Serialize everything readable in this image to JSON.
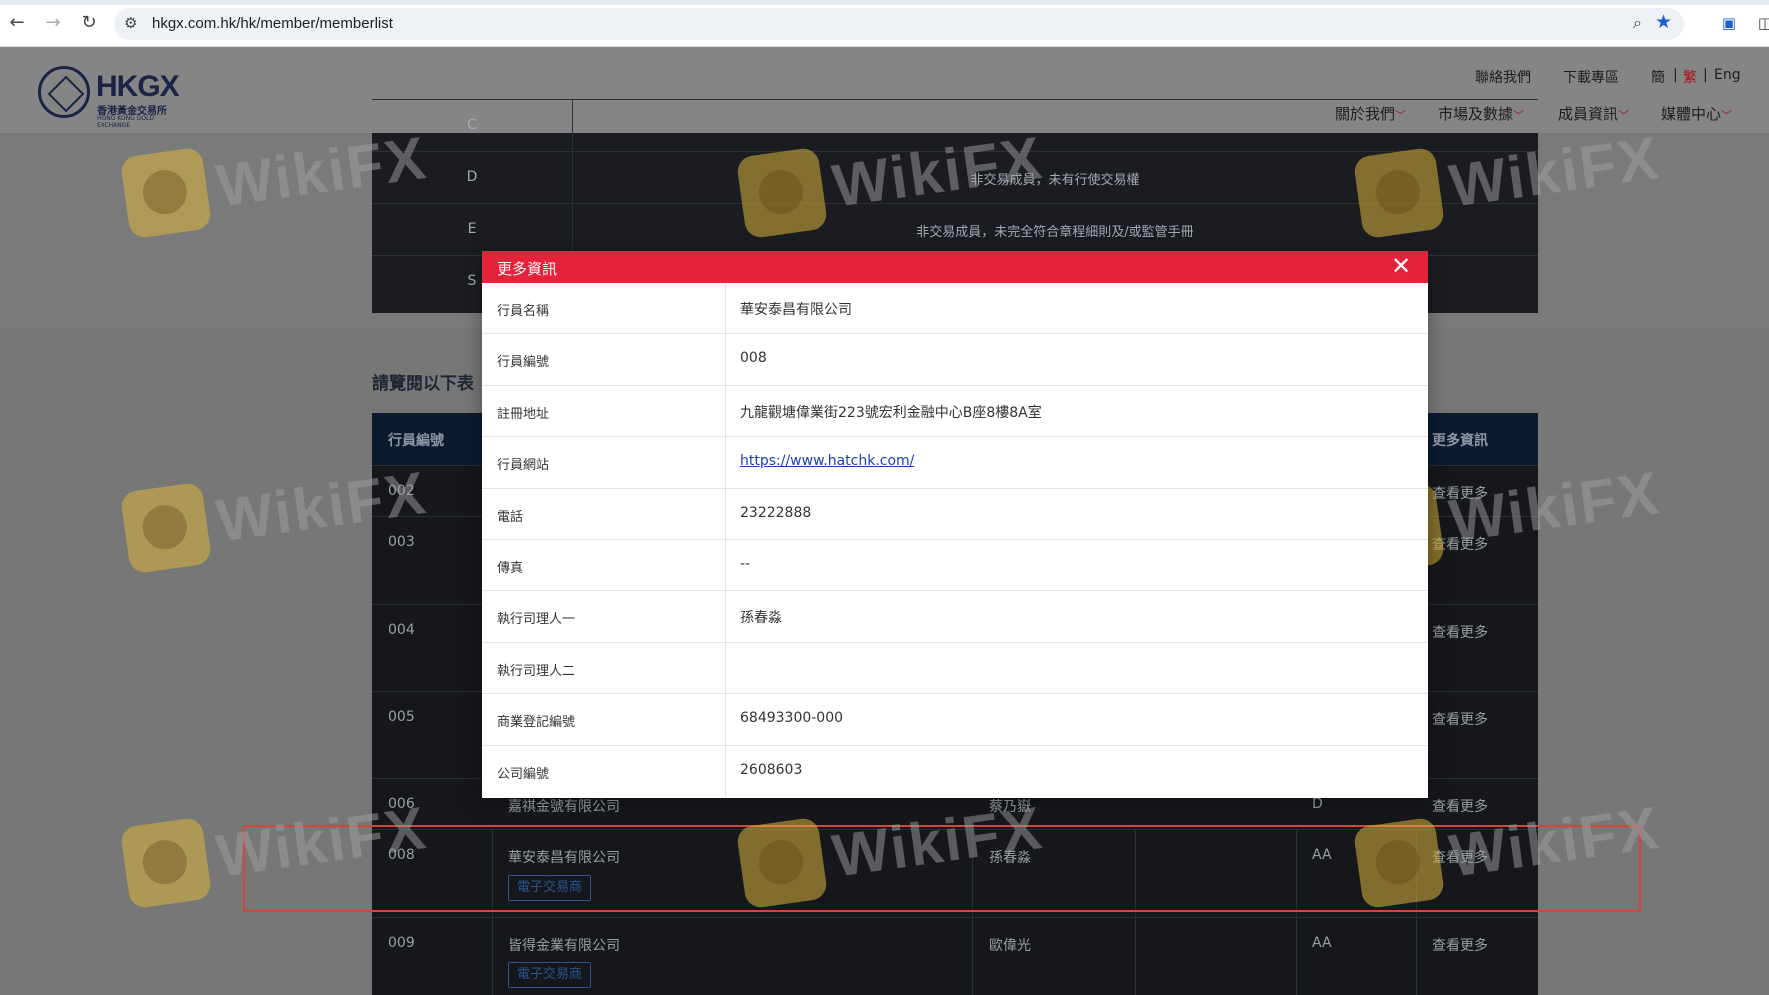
{
  "browser": {
    "url": "hkgx.com.hk/hk/member/memberlist"
  },
  "site": {
    "logo_mark": "HKGX",
    "logo_cn": "香港黃金交易所",
    "logo_en": "HONG KONG GOLD EXCHANGE",
    "top_links": [
      "聯絡我們",
      "下載專區"
    ],
    "lang": [
      "簡",
      "繁",
      "Eng"
    ],
    "nav": [
      "關於我們",
      "市場及數據",
      "成員資訊",
      "媒體中心"
    ]
  },
  "top_table": [
    {
      "code": "C",
      "desc": ""
    },
    {
      "code": "D",
      "desc": "非交易成員，未有行使交易權"
    },
    {
      "code": "E",
      "desc": "非交易成員，未完全符合章程細則及/或監管手冊"
    },
    {
      "code": "S",
      "desc": ""
    }
  ],
  "section_title": "請覽閱以下表",
  "member_table": {
    "headers": [
      "行員編號",
      "更多資訊"
    ],
    "rows": [
      {
        "id": "002",
        "name": "",
        "tag": "",
        "person": "",
        "grade": "",
        "more": "查看更多"
      },
      {
        "id": "003",
        "name": "",
        "tag": "",
        "person": "",
        "grade": "",
        "more": "查看更多"
      },
      {
        "id": "004",
        "name": "",
        "tag": "",
        "person": "",
        "grade": "",
        "more": "查看更多"
      },
      {
        "id": "005",
        "name": "",
        "tag": "",
        "person": "",
        "grade": "",
        "more": "查看更多"
      },
      {
        "id": "006",
        "name": "嘉祺金號有限公司",
        "tag": "",
        "person": "蔡乃嶽",
        "grade": "D",
        "more": "查看更多"
      },
      {
        "id": "008",
        "name": "華安泰昌有限公司",
        "tag": "電子交易商",
        "person": "孫春淼",
        "grade": "AA",
        "more": "查看更多"
      },
      {
        "id": "009",
        "name": "皆得金業有限公司",
        "tag": "電子交易商",
        "person": "歐偉光",
        "grade": "AA",
        "more": "查看更多"
      }
    ]
  },
  "modal": {
    "title": "更多資訊",
    "rows": [
      {
        "label": "行員名稱",
        "value": "華安泰昌有限公司"
      },
      {
        "label": "行員編號",
        "value": "008"
      },
      {
        "label": "註冊地址",
        "value": "九龍觀塘偉業街223號宏利金融中心B座8樓8A室"
      },
      {
        "label": "行員網站",
        "value": "https://www.hatchk.com/"
      },
      {
        "label": "電話",
        "value": "23222888"
      },
      {
        "label": "傳真",
        "value": "--"
      },
      {
        "label": "執行司理人一",
        "value": "孫春淼"
      },
      {
        "label": "執行司理人二",
        "value": ""
      },
      {
        "label": "商業登記編號",
        "value": "68493300-000"
      },
      {
        "label": "公司編號",
        "value": "2608603"
      }
    ]
  },
  "watermark": "WikiFX",
  "colors": {
    "modal_header": "#e4233a",
    "link": "#1a3eb8",
    "highlight": "#d8433c",
    "table_bg": "#15171b"
  }
}
